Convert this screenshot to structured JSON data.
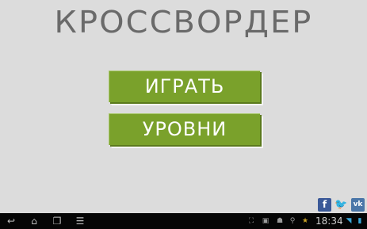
{
  "app": {
    "title": "КРОССВОРДЕР",
    "menu": {
      "play_label": "ИГРАТЬ",
      "levels_label": "УРОВНИ"
    },
    "social": {
      "facebook_label": "f",
      "twitter_label": "t",
      "vk_label": "vk"
    }
  },
  "system_bar": {
    "clock": "18:34"
  },
  "colors": {
    "background": "#dcdcdc",
    "title": "#6a6a6a",
    "button": "#7aa12b",
    "facebook": "#3b5998",
    "twitter": "#3aa0e0",
    "vk": "#4a76a8"
  }
}
